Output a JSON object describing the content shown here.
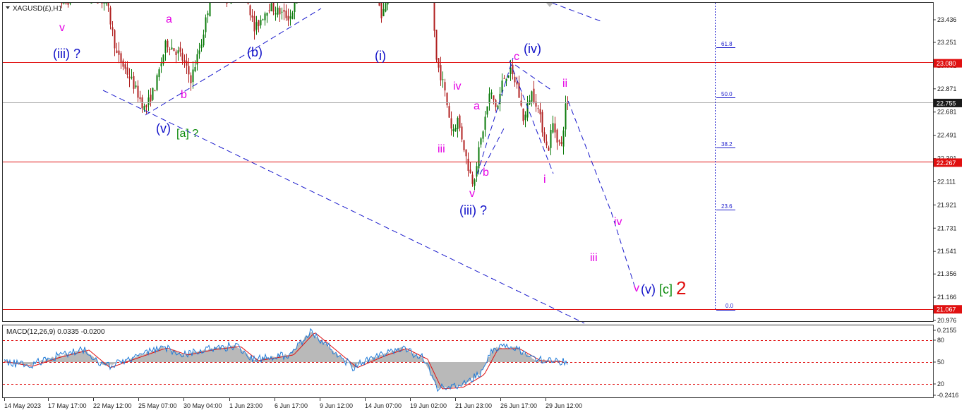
{
  "chart_header": {
    "symbol_label": "XAGUSD(£),H1",
    "triangle_icon": "dropdown-triangle-icon"
  },
  "price_axis": {
    "ticks": [
      "23.436",
      "23.251",
      "23.061",
      "22.871",
      "22.681",
      "22.491",
      "22.301",
      "22.111",
      "21.921",
      "21.731",
      "21.541",
      "21.356",
      "21.166",
      "20.976"
    ],
    "tagged_prices": [
      {
        "value": "23.080",
        "color": "#e01010"
      },
      {
        "value": "22.755",
        "color": "#1a1a1a"
      },
      {
        "value": "22.267",
        "color": "#e01010"
      },
      {
        "value": "21.067",
        "color": "#e01010"
      }
    ]
  },
  "time_axis": {
    "labels": [
      "14 May 2023",
      "17 May 17:00",
      "22 May 12:00",
      "25 May 07:00",
      "30 May 04:00",
      "1 Jun 23:00",
      "6 Jun 17:00",
      "9 Jun 12:00",
      "14 Jun 07:00",
      "19 Jun 02:00",
      "21 Jun 23:00",
      "26 Jun 17:00",
      "29 Jun 12:00"
    ]
  },
  "fibonacci": {
    "levels": [
      "61.8",
      "50.0",
      "38.2",
      "23.6",
      "0.0"
    ]
  },
  "wave_labels": [
    {
      "text": "v",
      "color": "#e400e4"
    },
    {
      "text": "(iii) ?",
      "color": "#1010c8"
    },
    {
      "text": "a",
      "color": "#e400e4"
    },
    {
      "text": "b",
      "color": "#e400e4"
    },
    {
      "text": "(v)",
      "color": "#1010c8"
    },
    {
      "text": "[a] ?",
      "color": "#0a8a0a"
    },
    {
      "text": "(b)",
      "color": "#1010c8"
    },
    {
      "text": "(i)",
      "color": "#1010c8"
    },
    {
      "text": "iv",
      "color": "#e400e4"
    },
    {
      "text": "iii",
      "color": "#e400e4"
    },
    {
      "text": "a",
      "color": "#e400e4"
    },
    {
      "text": "b",
      "color": "#e400e4"
    },
    {
      "text": "v",
      "color": "#e400e4"
    },
    {
      "text": "(iii) ?",
      "color": "#1010c8"
    },
    {
      "text": "c",
      "color": "#e400e4"
    },
    {
      "text": "(iv)",
      "color": "#1010c8"
    },
    {
      "text": "ii",
      "color": "#e400e4"
    },
    {
      "text": "i",
      "color": "#e400e4"
    },
    {
      "text": "iv",
      "color": "#e400e4"
    },
    {
      "text": "iii",
      "color": "#e400e4"
    },
    {
      "text": "v",
      "color": "#e400e4"
    },
    {
      "text": "(v)",
      "color": "#1010c8"
    },
    {
      "text": "[c]",
      "color": "#0a8a0a"
    },
    {
      "text": "2",
      "color": "#e01010"
    }
  ],
  "macd": {
    "label": "MACD(12,26,9) 0.0335 -0.0200",
    "axis_ticks": [
      "0.2155",
      "80",
      "50",
      "20",
      "-0.2416"
    ]
  },
  "colors": {
    "up_candle": "#0a7a0a",
    "down_candle": "#b02020",
    "support_line": "#e01010",
    "trendline": "#1a1acc",
    "macd_signal": "#e01010",
    "macd_main": "#1e7ad8",
    "macd_histogram": "#b9b9b9"
  },
  "chart_data": [
    {
      "type": "candlestick",
      "symbol": "XAGUSD(£)",
      "timeframe": "H1",
      "x_range": [
        "14 May 2023",
        "29 Jun 12:00"
      ],
      "y_range": [
        20.976,
        23.436
      ],
      "horizontal_levels": [
        23.08,
        22.755,
        22.267,
        21.067
      ],
      "approx_close_path": [
        {
          "x": "14 May 2023",
          "y": 23.5
        },
        {
          "x": "17 May 17:00",
          "y": 23.35
        },
        {
          "x": "22 May 12:00",
          "y": 23.1
        },
        {
          "x": "25 May 07:00",
          "y": 22.7
        },
        {
          "x": "30 May 04:00",
          "y": 23.25
        },
        {
          "x": "1 Jun 23:00",
          "y": 23.45
        },
        {
          "x": "6 Jun 17:00",
          "y": 23.5
        },
        {
          "x": "14 Jun 07:00",
          "y": 23.4
        },
        {
          "x": "19 Jun 02:00",
          "y": 23.0
        },
        {
          "x": "21 Jun 23:00",
          "y": 22.15
        },
        {
          "x": "26 Jun 17:00",
          "y": 22.9
        },
        {
          "x": "29 Jun 12:00",
          "y": 22.755
        }
      ]
    },
    {
      "type": "line",
      "indicator": "MACD(12,26,9)",
      "main": 0.0335,
      "signal": -0.02,
      "y_range": [
        -0.2416,
        0.2155
      ]
    }
  ]
}
